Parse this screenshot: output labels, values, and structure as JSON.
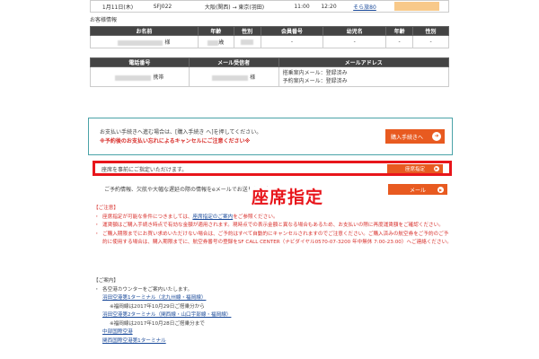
{
  "flight": {
    "date": "1月11日(木)",
    "number": "SFJ022",
    "route": "大阪(関西) → 東京(羽田)",
    "departure": "11:00",
    "arrival": "12:20",
    "seat_link": "そら旅80"
  },
  "customer": {
    "section_title": "お客様情報",
    "headers": [
      "お名前",
      "年齢",
      "性別",
      "会員番号",
      "幼児名",
      "年齢",
      "性別"
    ],
    "row": {
      "name_suffix": "様",
      "age_suffix": "歳",
      "member": "-",
      "infant": "-",
      "infant_age": "-",
      "infant_gender": "-"
    }
  },
  "contact": {
    "headers": [
      "電話番号",
      "メール受信者",
      "メールアドレス"
    ],
    "phone_type": "携帯",
    "recipient_suffix": "様",
    "mail_lines": [
      "搭乗案内メール：登録済み",
      "予約案内メール：登録済み"
    ]
  },
  "purchase": {
    "text1": "お支払い手続きへ進む場合は、[購入手続き へ]を押してください。",
    "text2": "※予約後のお支払い忘れによるキャンセルにご注意ください※",
    "button": "購入手続きへ"
  },
  "seat": {
    "text": "座席を事前にご指定いただけます。",
    "button": "座席指定"
  },
  "email": {
    "text": "ご予約情報、欠航や大幅な遅延の際の情報をeメールでお送りします。",
    "button": "メール"
  },
  "overlay": {
    "label": "座席指定"
  },
  "notes": {
    "heading": "【ご注意】",
    "items": [
      {
        "pre": "座席指定が可能な条件につきましては、",
        "link": "座席指定のご案内",
        "post": "をご参照ください。"
      },
      {
        "text": "運賃額はご購入手続き時点で有効な金額が適用されます。現時点での表示金額と異なる場合もあるため、お支払いの際に再度運賃額をご確認ください。"
      },
      {
        "text": "ご購入期限までにお買い求めいただけない場合は、ご予約はすべて自動的にキャンセルされますのでご注意ください。ご購入済みの航空券をご予約のご予約に使用する場合は、購入期限までに、航空券番号の登録をSF CALL CENTER（ナビダイヤル0570-07-3200 年中無休 7:00-23:00）へご連絡ください。"
      }
    ]
  },
  "guide": {
    "heading": "【ご案内】",
    "intro": "各空港カウンターをご案内いたします。",
    "links": [
      {
        "label": "羽田空港第1ターミナル（北九州線・福岡線）",
        "note": "※福岡線は2017年10月29日ご搭乗分から"
      },
      {
        "label": "羽田空港第2ターミナル（関西線・山口宇部線・福岡線）",
        "note": "※福岡線は2017年10月28日ご搭乗分まで"
      },
      {
        "label": "中部国際空港",
        "note": ""
      },
      {
        "label": "関西国際空港第1ターミナル",
        "note": ""
      }
    ]
  }
}
